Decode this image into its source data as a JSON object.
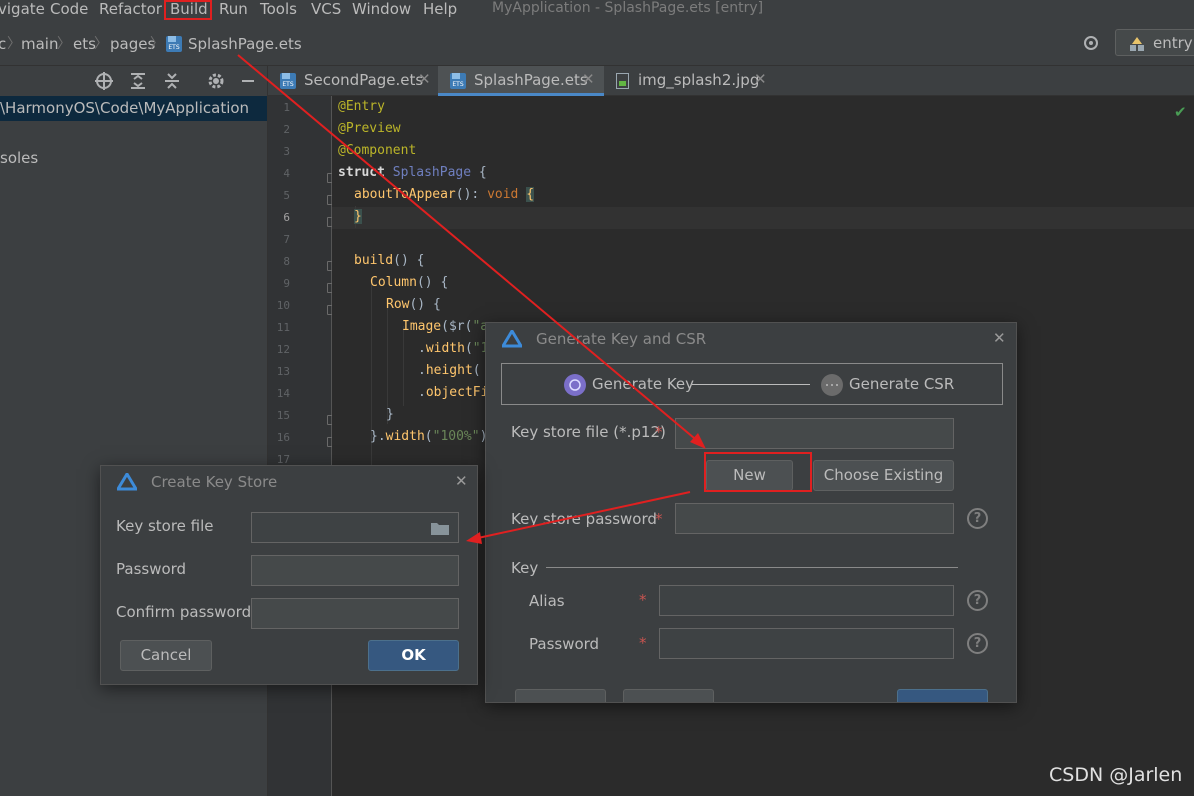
{
  "menu": {
    "items": [
      "vigate",
      "Code",
      "Refactor",
      "Build",
      "Run",
      "Tools",
      "VCS",
      "Window",
      "Help"
    ],
    "window_title": "MyApplication - SplashPage.ets [entry]"
  },
  "breadcrumb": {
    "items": [
      "c",
      "main",
      "ets",
      "pages",
      "SplashPage.ets"
    ]
  },
  "run_config": {
    "label": "entry"
  },
  "project_panel": {
    "path": "\\HarmonyOS\\Code\\MyApplication",
    "item": "soles"
  },
  "tabs": [
    {
      "label": "SecondPage.ets",
      "active": false
    },
    {
      "label": "SplashPage.ets",
      "active": true
    },
    {
      "label": "img_splash2.jpg",
      "active": false
    }
  ],
  "editor": {
    "line_numbers": [
      "1",
      "2",
      "3",
      "4",
      "5",
      "6",
      "7",
      "8",
      "9",
      "10",
      "11",
      "12",
      "13",
      "14",
      "15",
      "16",
      "17"
    ],
    "current_line": 6
  },
  "generate_dialog": {
    "title": "Generate Key and CSR",
    "step1": "Generate Key",
    "step2": "Generate CSR",
    "keystore_file_label": "Key store file (*.p12)",
    "new_button": "New",
    "choose_existing_button": "Choose Existing",
    "keystore_password_label": "Key store password",
    "key_section_label": "Key",
    "alias_label": "Alias",
    "password_label": "Password",
    "required_mark": "*",
    "help_mark": "?"
  },
  "keystore_dialog": {
    "title": "Create Key Store",
    "file_label": "Key store file",
    "password_label": "Password",
    "confirm_label": "Confirm password",
    "cancel_button": "Cancel",
    "ok_button": "OK"
  },
  "watermark": "CSDN @Jarlen",
  "colors": {
    "annotation_red": "#e02020",
    "accent_blue": "#4a88c7",
    "primary_button": "#365880"
  }
}
